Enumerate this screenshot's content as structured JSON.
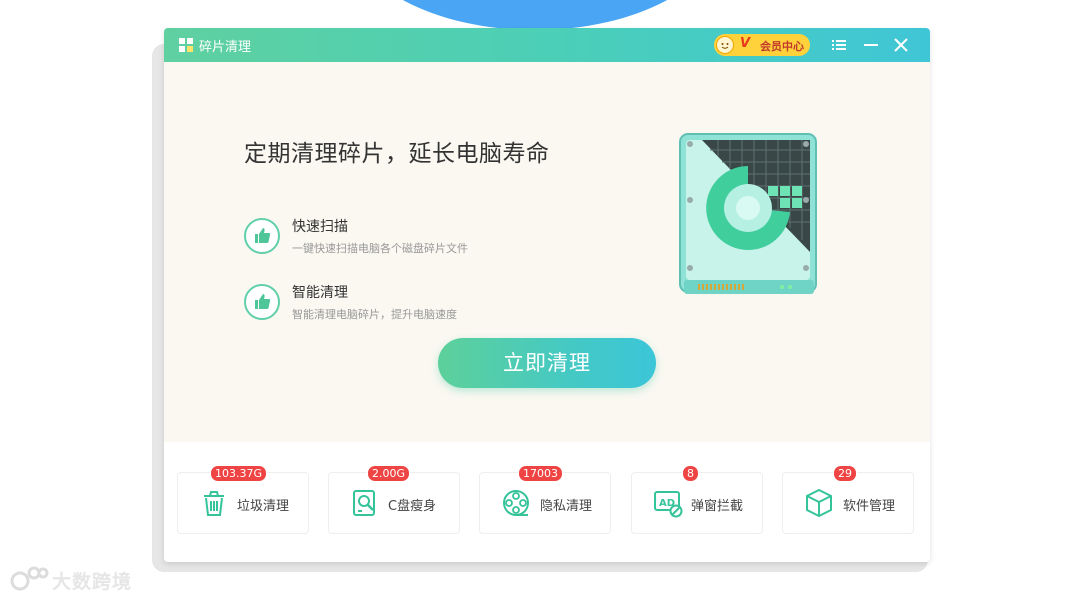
{
  "window": {
    "title": "碎片清理"
  },
  "vip": {
    "badge": "V",
    "label": "会员中心"
  },
  "hero": {
    "headline": "定期清理碎片，延长电脑寿命",
    "features": [
      {
        "title": "快速扫描",
        "description": "一键快速扫描电脑各个磁盘碎片文件"
      },
      {
        "title": "智能清理",
        "description": "智能清理电脑碎片，提升电脑速度"
      }
    ],
    "cta_label": "立即清理"
  },
  "tools": [
    {
      "label": "垃圾清理",
      "badge": "103.37G",
      "icon": "trash-icon"
    },
    {
      "label": "C盘瘦身",
      "badge": "2.00G",
      "icon": "disk-slim-icon"
    },
    {
      "label": "隐私清理",
      "badge": "17003",
      "icon": "film-reel-icon"
    },
    {
      "label": "弹窗拦截",
      "badge": "8",
      "icon": "ad-block-icon"
    },
    {
      "label": "软件管理",
      "badge": "29",
      "icon": "package-cube-icon"
    }
  ],
  "watermark": {
    "text": "大数跨境"
  },
  "colors": {
    "accent_green": "#5fd0a0",
    "accent_teal": "#3fc6d6",
    "badge_red": "#ef4444",
    "vip_yellow": "#ffd23c"
  }
}
